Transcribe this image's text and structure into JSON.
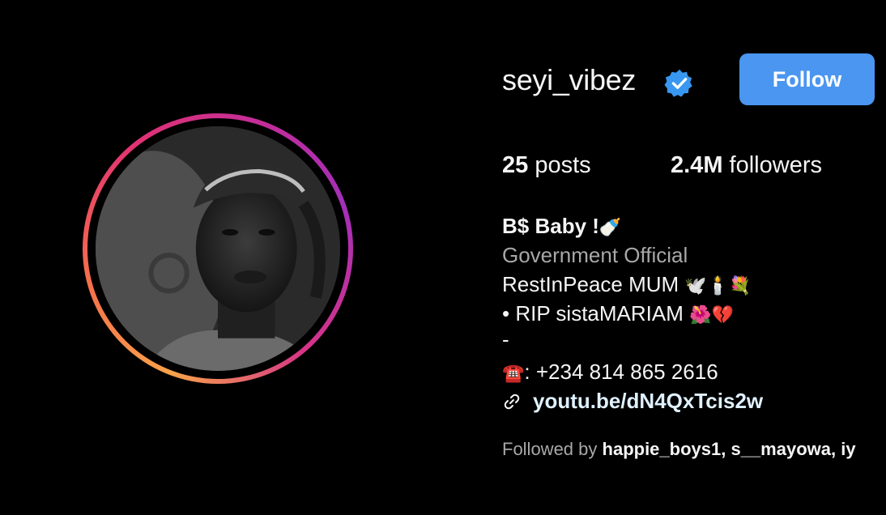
{
  "profile": {
    "username": "seyi_vibez",
    "verified_icon": "verified-badge-icon",
    "follow_label": "Follow",
    "accent_color": "#4a96f0"
  },
  "stats": {
    "posts_count": "25",
    "posts_label": "posts",
    "followers_count": "2.4M",
    "followers_label": "followers"
  },
  "bio": {
    "name": "B$ Baby !",
    "name_emoji": "🍼",
    "category": "Government Official",
    "line1_text": "RestInPeace MUM ",
    "line1_emoji": "🕊️🕯️💐",
    "line2_text": "• RIP sistaMARIAM ",
    "line2_emoji": "🌺💔",
    "line3": "-",
    "phone_emoji": "☎️",
    "phone_text": ": +234 814 865 2616",
    "link_text": "youtu.be/dN4QxTcis2w"
  },
  "followed_by": {
    "prefix": "Followed by ",
    "names": "happie_boys1, s__mayowa, iy"
  }
}
